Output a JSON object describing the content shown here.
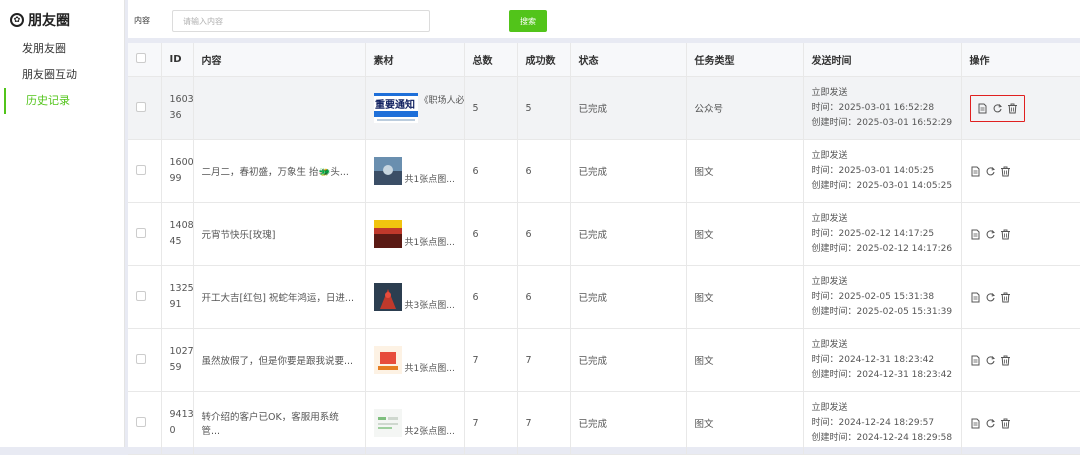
{
  "sidebar": {
    "title": "朋友圈",
    "items": [
      {
        "label": "发朋友圈",
        "active": false
      },
      {
        "label": "朋友圈互动",
        "active": false
      },
      {
        "label": "历史记录",
        "active": true
      }
    ]
  },
  "search": {
    "label": "内容",
    "placeholder": "请输入内容",
    "value": "",
    "button": "搜索"
  },
  "table": {
    "headers": [
      "",
      "ID",
      "内容",
      "素材",
      "总数",
      "成功数",
      "状态",
      "任务类型",
      "发送时间",
      "操作"
    ],
    "rows": [
      {
        "id_l1": "1603",
        "id_l2": "36",
        "content": "",
        "material_image": "重要通知",
        "material_text": "《职场人必备",
        "total": "5",
        "success": "5",
        "status": "已完成",
        "task_type": "公众号",
        "send_mode": "立即发送",
        "send_time": "时间：2025-03-01 16:52:28",
        "create_time": "创建时间：2025-03-01 16:52:29"
      },
      {
        "id_l1": "1600",
        "id_l2": "99",
        "content": "二月二，春初盛，万象生 抬🐲头...",
        "material_text": "共1张点图...",
        "total": "6",
        "success": "6",
        "status": "已完成",
        "task_type": "图文",
        "send_mode": "立即发送",
        "send_time": "时间：2025-03-01 14:05:25",
        "create_time": "创建时间：2025-03-01 14:05:25"
      },
      {
        "id_l1": "1408",
        "id_l2": "45",
        "content": "元宵节快乐[玫瑰]",
        "material_text": "共1张点图...",
        "total": "6",
        "success": "6",
        "status": "已完成",
        "task_type": "图文",
        "send_mode": "立即发送",
        "send_time": "时间：2025-02-12 14:17:25",
        "create_time": "创建时间：2025-02-12 14:17:26"
      },
      {
        "id_l1": "1325",
        "id_l2": "91",
        "content": "开工大吉[红包] 祝蛇年鸿运，日进...",
        "material_text": "共3张点图...",
        "total": "6",
        "success": "6",
        "status": "已完成",
        "task_type": "图文",
        "send_mode": "立即发送",
        "send_time": "时间：2025-02-05 15:31:38",
        "create_time": "创建时间：2025-02-05 15:31:39"
      },
      {
        "id_l1": "1027",
        "id_l2": "59",
        "content": "虽然放假了，但是你要是跟我说要...",
        "material_text": "共1张点图...",
        "total": "7",
        "success": "7",
        "status": "已完成",
        "task_type": "图文",
        "send_mode": "立即发送",
        "send_time": "时间：2024-12-31 18:23:42",
        "create_time": "创建时间：2024-12-31 18:23:42"
      },
      {
        "id_l1": "9413",
        "id_l2": "0",
        "content": "转介绍的客户已OK，客服用系统管...",
        "material_text": "共2张点图...",
        "total": "7",
        "success": "7",
        "status": "已完成",
        "task_type": "图文",
        "send_mode": "立即发送",
        "send_time": "时间：2024-12-24 18:29:57",
        "create_time": "创建时间：2024-12-24 18:29:58"
      }
    ]
  },
  "icons": [
    "settings-icon",
    "document-icon",
    "refresh-icon",
    "trash-icon"
  ],
  "colors": {
    "accent": "#52c41a",
    "highlight": "#e02020",
    "background": "#e8eaf3"
  }
}
